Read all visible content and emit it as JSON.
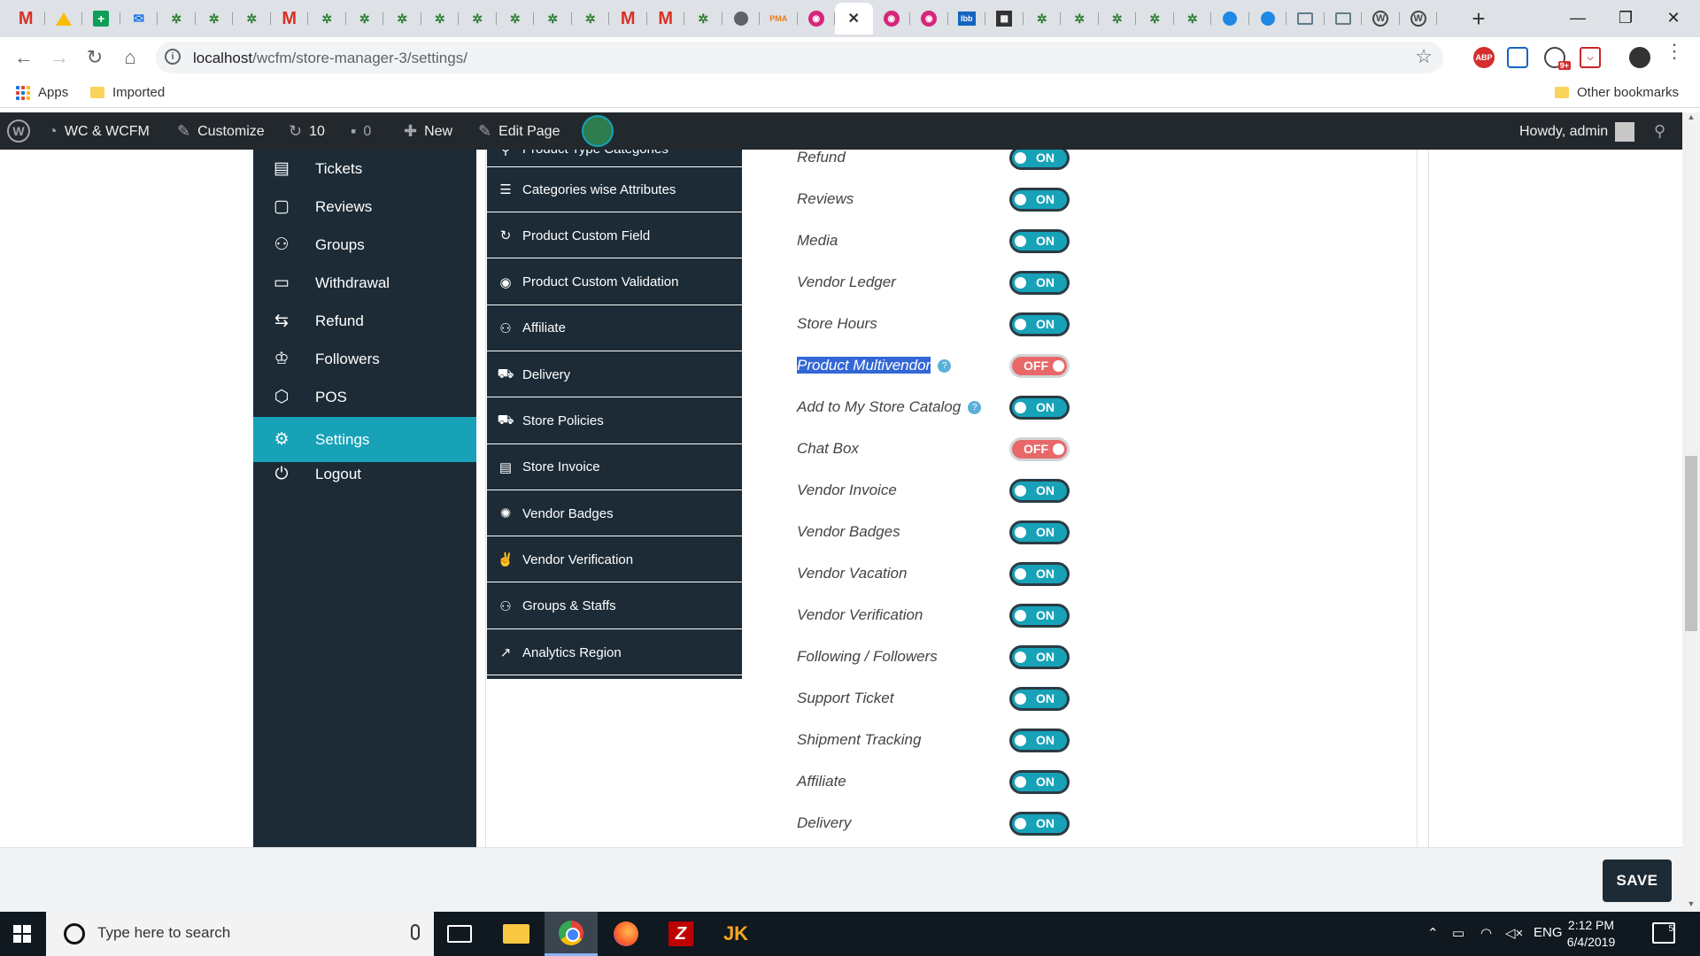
{
  "browser": {
    "tabs": [
      {
        "icon": "gmail-icon",
        "glyph": "M"
      },
      {
        "icon": "drive-icon",
        "glyph": ""
      },
      {
        "icon": "sheets-icon",
        "glyph": "+"
      },
      {
        "icon": "mail-icon",
        "glyph": "✉"
      },
      {
        "icon": "woocommerce-icon",
        "glyph": "✲"
      },
      {
        "icon": "woocommerce-icon",
        "glyph": "✲"
      },
      {
        "icon": "woocommerce-icon",
        "glyph": "✲"
      },
      {
        "icon": "gmail-icon",
        "glyph": "M"
      },
      {
        "icon": "woocommerce-icon",
        "glyph": "✲"
      },
      {
        "icon": "woocommerce-icon",
        "glyph": "✲"
      },
      {
        "icon": "woocommerce-icon",
        "glyph": "✲"
      },
      {
        "icon": "woocommerce-icon",
        "glyph": "✲"
      },
      {
        "icon": "woocommerce-icon",
        "glyph": "✲"
      },
      {
        "icon": "woocommerce-icon",
        "glyph": "✲"
      },
      {
        "icon": "woocommerce-icon",
        "glyph": "✲"
      },
      {
        "icon": "woocommerce-icon",
        "glyph": "✲"
      },
      {
        "icon": "gmail-icon",
        "glyph": "M"
      },
      {
        "icon": "gmail-icon",
        "glyph": "M"
      },
      {
        "icon": "woocommerce-icon",
        "glyph": "✲"
      },
      {
        "icon": "globe-icon",
        "glyph": ""
      },
      {
        "icon": "phpmyadmin-icon",
        "glyph": "PMA"
      },
      {
        "icon": "magenta-circle-icon",
        "glyph": "◉"
      },
      {
        "icon": "close-icon",
        "glyph": "✕",
        "active": true
      },
      {
        "icon": "magenta-circle-icon",
        "glyph": "◉"
      },
      {
        "icon": "magenta-circle-icon",
        "glyph": "◉"
      },
      {
        "icon": "lbb-icon",
        "glyph": "lbb"
      },
      {
        "icon": "film-icon",
        "glyph": "▦"
      },
      {
        "icon": "woocommerce-icon",
        "glyph": "✲"
      },
      {
        "icon": "woocommerce-icon",
        "glyph": "✲"
      },
      {
        "icon": "woocommerce-icon",
        "glyph": "✲"
      },
      {
        "icon": "woocommerce-icon",
        "glyph": "✲"
      },
      {
        "icon": "woocommerce-icon",
        "glyph": "✲"
      },
      {
        "icon": "blue-globe-icon",
        "glyph": ""
      },
      {
        "icon": "blue-globe-icon",
        "glyph": ""
      },
      {
        "icon": "monitor-icon",
        "glyph": ""
      },
      {
        "icon": "monitor-icon",
        "glyph": ""
      },
      {
        "icon": "wordpress-icon",
        "glyph": "W"
      },
      {
        "icon": "wordpress-icon",
        "glyph": "W"
      }
    ],
    "new_tab_glyph": "+",
    "window_controls": {
      "minimize": "—",
      "maximize": "❐",
      "close": "✕"
    },
    "url_host": "localhost",
    "url_path": "/wcfm/store-manager-3/settings/",
    "bookmarks": [
      {
        "label": "Apps",
        "icon": "apps-grid-icon"
      },
      {
        "label": "Imported",
        "icon": "folder-icon"
      },
      {
        "label": "Other bookmarks",
        "icon": "folder-icon"
      }
    ],
    "extensions": {
      "abp": "ABP",
      "badge": "9+"
    }
  },
  "adminbar": {
    "site": "WC & WCFM",
    "customize": "Customize",
    "updates": "10",
    "comments": "0",
    "new": "New",
    "edit_page": "Edit Page",
    "howdy": "Howdy, admin"
  },
  "menu_primary": [
    {
      "label": "Tickets",
      "icon": "ticket-icon",
      "glyph": "▤"
    },
    {
      "label": "Reviews",
      "icon": "comment-icon",
      "glyph": "▢"
    },
    {
      "label": "Groups",
      "icon": "users-icon",
      "glyph": "⚇"
    },
    {
      "label": "Withdrawal",
      "icon": "credit-card-icon",
      "glyph": "▭"
    },
    {
      "label": "Refund",
      "icon": "retweet-icon",
      "glyph": "⇆"
    },
    {
      "label": "Followers",
      "icon": "followers-icon",
      "glyph": "♔"
    },
    {
      "label": "POS",
      "icon": "cube-icon",
      "glyph": "⬡"
    },
    {
      "label": "Settings",
      "icon": "cogs-icon",
      "glyph": "⚙",
      "active": true
    },
    {
      "label": "Logout",
      "icon": "power-icon",
      "glyph": "⏻"
    }
  ],
  "menu_settings": [
    {
      "label": "Product Type Categories",
      "icon": "tags-icon",
      "glyph": "⚲",
      "partial": true
    },
    {
      "label": "Categories wise Attributes",
      "icon": "list-icon",
      "glyph": "☰"
    },
    {
      "label": "Product Custom Field",
      "icon": "refresh-icon",
      "glyph": "↻"
    },
    {
      "label": "Product Custom Validation",
      "icon": "eye-icon",
      "glyph": "◉"
    },
    {
      "label": "Affiliate",
      "icon": "users-icon",
      "glyph": "⚇"
    },
    {
      "label": "Delivery",
      "icon": "truck-icon",
      "glyph": "⛟"
    },
    {
      "label": "Store Policies",
      "icon": "ambulance-icon",
      "glyph": "⛟"
    },
    {
      "label": "Store Invoice",
      "icon": "file-icon",
      "glyph": "▤"
    },
    {
      "label": "Vendor Badges",
      "icon": "certificate-icon",
      "glyph": "✺"
    },
    {
      "label": "Vendor Verification",
      "icon": "medal-icon",
      "glyph": "✌"
    },
    {
      "label": "Groups & Staffs",
      "icon": "users-icon",
      "glyph": "⚇"
    },
    {
      "label": "Analytics Region",
      "icon": "chart-icon",
      "glyph": "↗"
    }
  ],
  "modules": [
    {
      "label": "Refund",
      "state": "ON"
    },
    {
      "label": "Reviews",
      "state": "ON"
    },
    {
      "label": "Media",
      "state": "ON"
    },
    {
      "label": "Vendor Ledger",
      "state": "ON"
    },
    {
      "label": "Store Hours",
      "state": "ON"
    },
    {
      "label": "Product Multivendor",
      "state": "OFF",
      "help": true,
      "highlight": true
    },
    {
      "label": "Add to My Store Catalog",
      "state": "ON",
      "help": true
    },
    {
      "label": "Chat Box",
      "state": "OFF"
    },
    {
      "label": "Vendor Invoice",
      "state": "ON"
    },
    {
      "label": "Vendor Badges",
      "state": "ON"
    },
    {
      "label": "Vendor Vacation",
      "state": "ON"
    },
    {
      "label": "Vendor Verification",
      "state": "ON"
    },
    {
      "label": "Following / Followers",
      "state": "ON"
    },
    {
      "label": "Support Ticket",
      "state": "ON"
    },
    {
      "label": "Shipment Tracking",
      "state": "ON"
    },
    {
      "label": "Affiliate",
      "state": "ON"
    },
    {
      "label": "Delivery",
      "state": "ON"
    }
  ],
  "save_label": "SAVE",
  "taskbar": {
    "search_placeholder": "Type here to search",
    "lang": "ENG",
    "time": "2:12 PM",
    "date": "6/4/2019",
    "notifications": "5"
  },
  "colors": {
    "menu_bg": "#1c2b36",
    "accent": "#17a2b8",
    "off": "#e8686a"
  }
}
